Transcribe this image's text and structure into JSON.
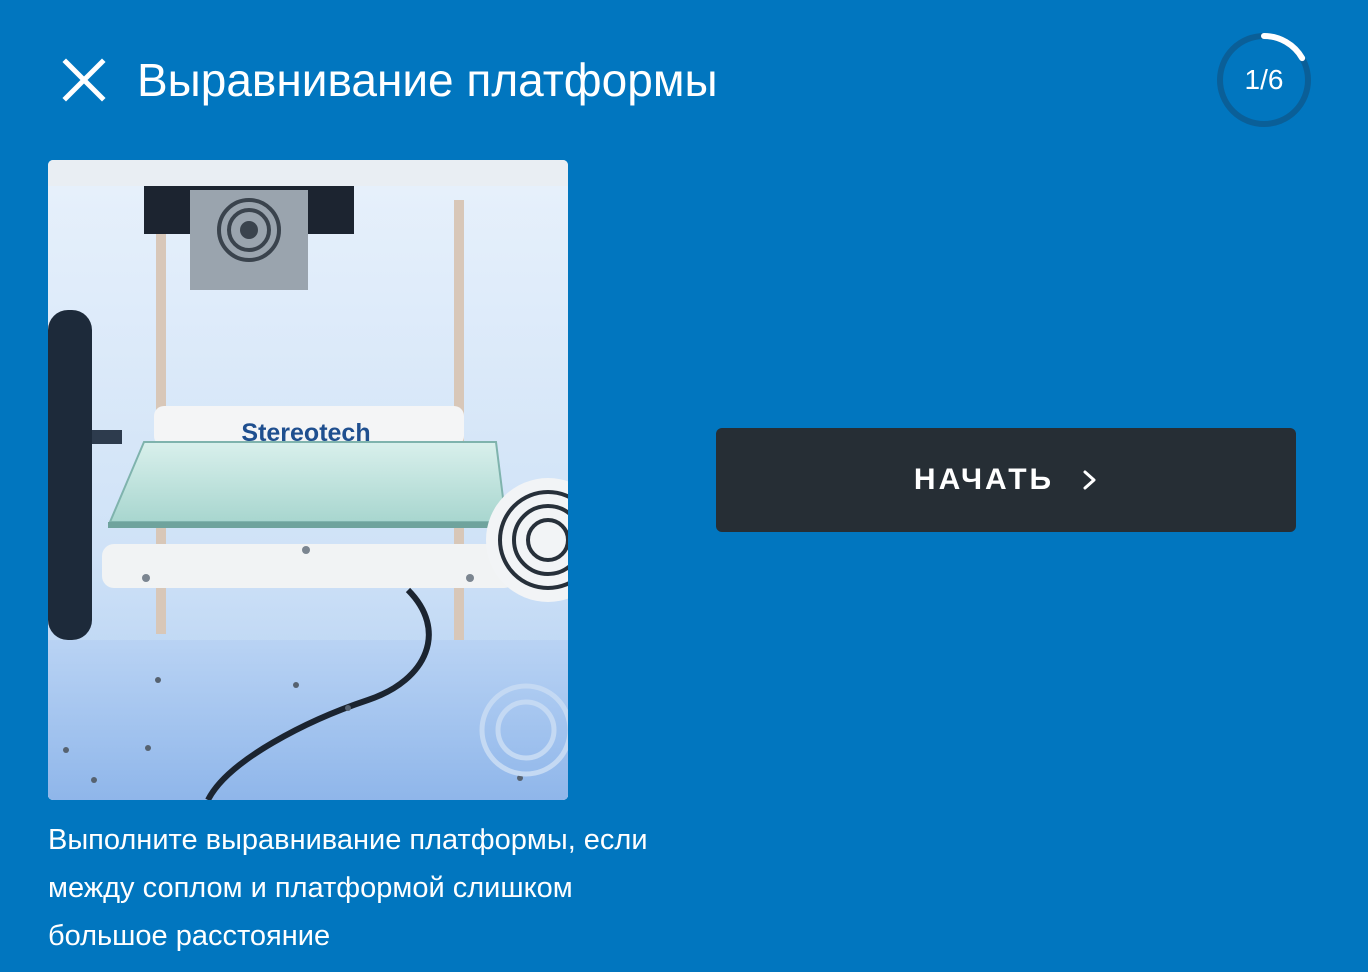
{
  "header": {
    "title": "Выравнивание платформы",
    "close_icon": "close-icon",
    "progress": {
      "label": "1/6",
      "current": 1,
      "total": 6
    }
  },
  "content": {
    "image": {
      "brand_text": "Stereotech"
    },
    "description": "Выполните выравнивание платформы, если между соплом и платформой слишком большое расстояние"
  },
  "actions": {
    "start_label": "НАЧАТЬ",
    "start_icon": "chevron-right-icon"
  },
  "colors": {
    "background": "#0176BF",
    "button": "#262E35",
    "text": "#FFFFFF"
  }
}
